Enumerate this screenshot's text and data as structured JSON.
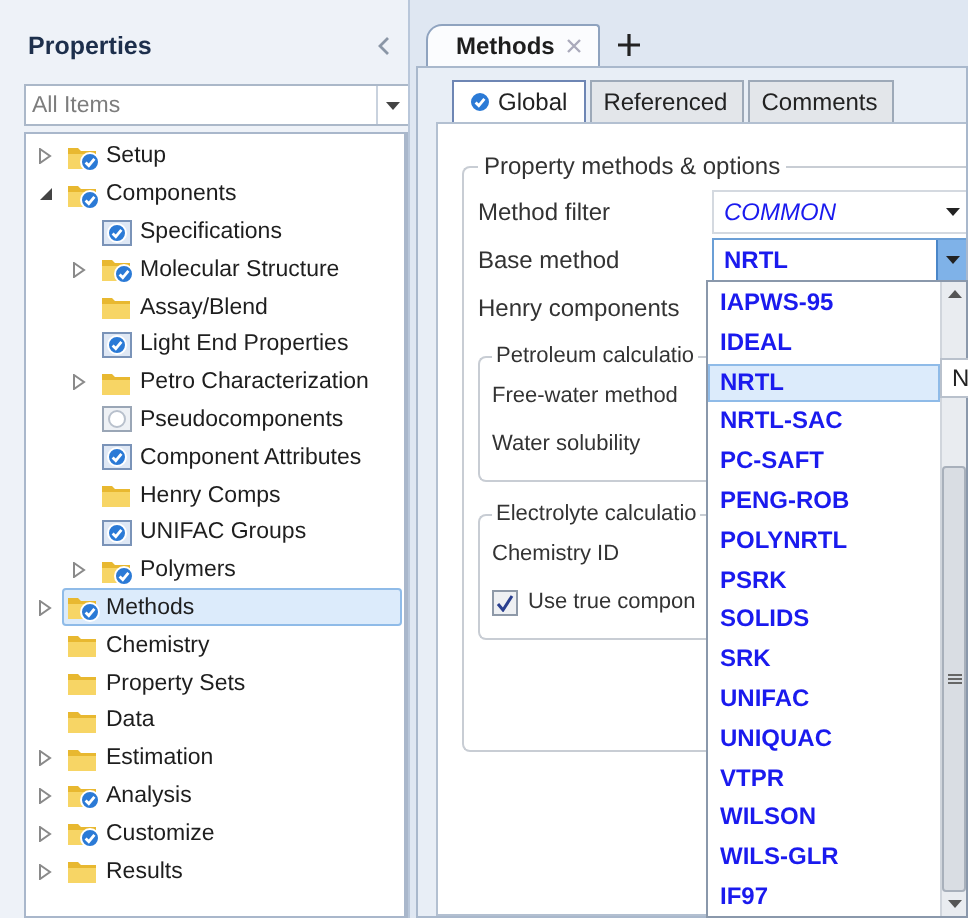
{
  "panel": {
    "title": "Properties",
    "filter": {
      "value": "All Items"
    },
    "tree": [
      {
        "label": "Setup",
        "kind": "folder-check",
        "expanded": false,
        "selected": false
      },
      {
        "label": "Components",
        "kind": "folder-check",
        "expanded": true,
        "selected": false,
        "children": [
          {
            "label": "Specifications",
            "kind": "form-check",
            "selected": false
          },
          {
            "label": "Molecular Structure",
            "kind": "folder-check",
            "expanded": false,
            "selected": false
          },
          {
            "label": "Assay/Blend",
            "kind": "folder",
            "selected": false
          },
          {
            "label": "Light End Properties",
            "kind": "form-check",
            "selected": false
          },
          {
            "label": "Petro Characterization",
            "kind": "folder",
            "expanded": false,
            "selected": false
          },
          {
            "label": "Pseudocomponents",
            "kind": "form-empty",
            "selected": false
          },
          {
            "label": "Component Attributes",
            "kind": "form-check",
            "selected": false
          },
          {
            "label": "Henry Comps",
            "kind": "folder",
            "selected": false
          },
          {
            "label": "UNIFAC Groups",
            "kind": "form-check",
            "selected": false
          },
          {
            "label": "Polymers",
            "kind": "folder-check",
            "expanded": false,
            "selected": false
          }
        ]
      },
      {
        "label": "Methods",
        "kind": "folder-check",
        "expanded": false,
        "selected": true
      },
      {
        "label": "Chemistry",
        "kind": "folder",
        "selected": false
      },
      {
        "label": "Property Sets",
        "kind": "folder",
        "selected": false
      },
      {
        "label": "Data",
        "kind": "folder",
        "selected": false
      },
      {
        "label": "Estimation",
        "kind": "folder",
        "expanded": false,
        "selected": false
      },
      {
        "label": "Analysis",
        "kind": "folder-check",
        "expanded": false,
        "selected": false
      },
      {
        "label": "Customize",
        "kind": "folder-check",
        "expanded": false,
        "selected": false
      },
      {
        "label": "Results",
        "kind": "folder",
        "expanded": false,
        "selected": false
      }
    ]
  },
  "doc_tabs": [
    {
      "label": "Methods",
      "selected": true
    }
  ],
  "sub_tabs": [
    {
      "label": "Global",
      "selected": true,
      "checked": true
    },
    {
      "label": "Referenced",
      "selected": false
    },
    {
      "label": "Comments",
      "selected": false
    }
  ],
  "group": {
    "title": "Property methods & options",
    "rows": [
      {
        "label": "Method filter",
        "kind": "filter-combo",
        "value": "COMMON"
      },
      {
        "label": "Base method",
        "kind": "method-combo",
        "value": "NRTL",
        "open": true
      },
      {
        "label": "Henry components",
        "kind": "plain"
      }
    ],
    "subgroups": [
      {
        "title": "Petroleum calculatio",
        "rows": [
          {
            "label": "Free-water method",
            "kind": "plain"
          },
          {
            "label": "Water solubility",
            "kind": "plain"
          }
        ]
      },
      {
        "title": "Electrolyte calculatio",
        "rows": [
          {
            "label": "Chemistry ID",
            "kind": "plain"
          },
          {
            "label": "Use true compon",
            "kind": "checkbox",
            "checked": true
          }
        ]
      }
    ]
  },
  "dropdown": {
    "items": [
      {
        "label": "IAPWS-95",
        "selected": false
      },
      {
        "label": "IDEAL",
        "selected": false
      },
      {
        "label": "NRTL",
        "selected": true
      },
      {
        "label": "NRTL-SAC",
        "selected": false
      },
      {
        "label": "PC-SAFT",
        "selected": false
      },
      {
        "label": "PENG-ROB",
        "selected": false
      },
      {
        "label": "POLYNRTL",
        "selected": false
      },
      {
        "label": "PSRK",
        "selected": false
      },
      {
        "label": "SOLIDS",
        "selected": false
      },
      {
        "label": "SRK",
        "selected": false
      },
      {
        "label": "UNIFAC",
        "selected": false
      },
      {
        "label": "UNIQUAC",
        "selected": false
      },
      {
        "label": "VTPR",
        "selected": false
      },
      {
        "label": "WILSON",
        "selected": false
      },
      {
        "label": "WILS-GLR",
        "selected": false
      },
      {
        "label": "IF97",
        "selected": false
      }
    ],
    "tooltip": "N"
  }
}
